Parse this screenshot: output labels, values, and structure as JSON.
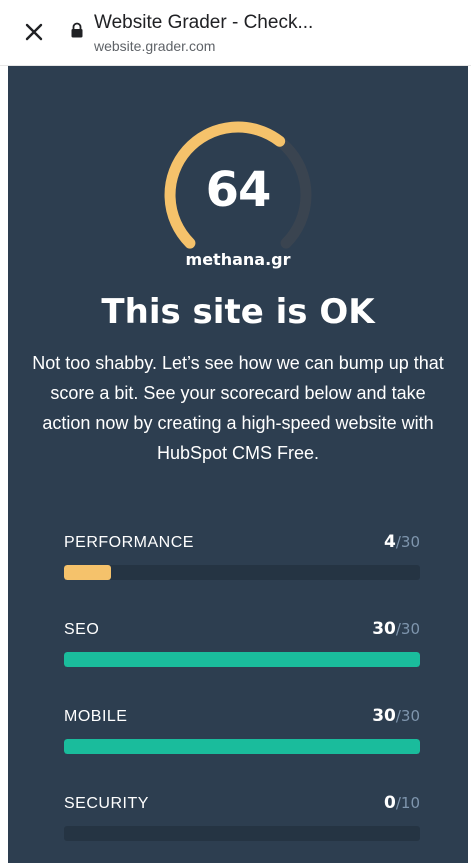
{
  "browser": {
    "title": "Website Grader - Check...",
    "url": "website.grader.com",
    "icons": {
      "close": "close-icon",
      "lock": "lock-icon"
    }
  },
  "grade": {
    "score": "64",
    "score_fraction": 0.64,
    "domain": "methana.gr",
    "headline": "This site is OK",
    "description": "Not too shabby. Let’s see how we can bump up that score a bit. See your scorecard below and take action now by creating a high-speed website with HubSpot CMS Free."
  },
  "colors": {
    "panel": "#2d3e50",
    "accent_yellow": "#f5c26b",
    "accent_teal": "#1abc9c",
    "track": "#253443",
    "gauge_track": "#3a4450"
  },
  "metrics": [
    {
      "label": "PERFORMANCE",
      "score": "4",
      "max": "/30",
      "fraction": 0.1333,
      "color": "#f5c26b"
    },
    {
      "label": "SEO",
      "score": "30",
      "max": "/30",
      "fraction": 1.0,
      "color": "#1abc9c"
    },
    {
      "label": "MOBILE",
      "score": "30",
      "max": "/30",
      "fraction": 1.0,
      "color": "#1abc9c"
    },
    {
      "label": "SECURITY",
      "score": "0",
      "max": "/10",
      "fraction": 0.0,
      "color": "#1abc9c"
    }
  ]
}
